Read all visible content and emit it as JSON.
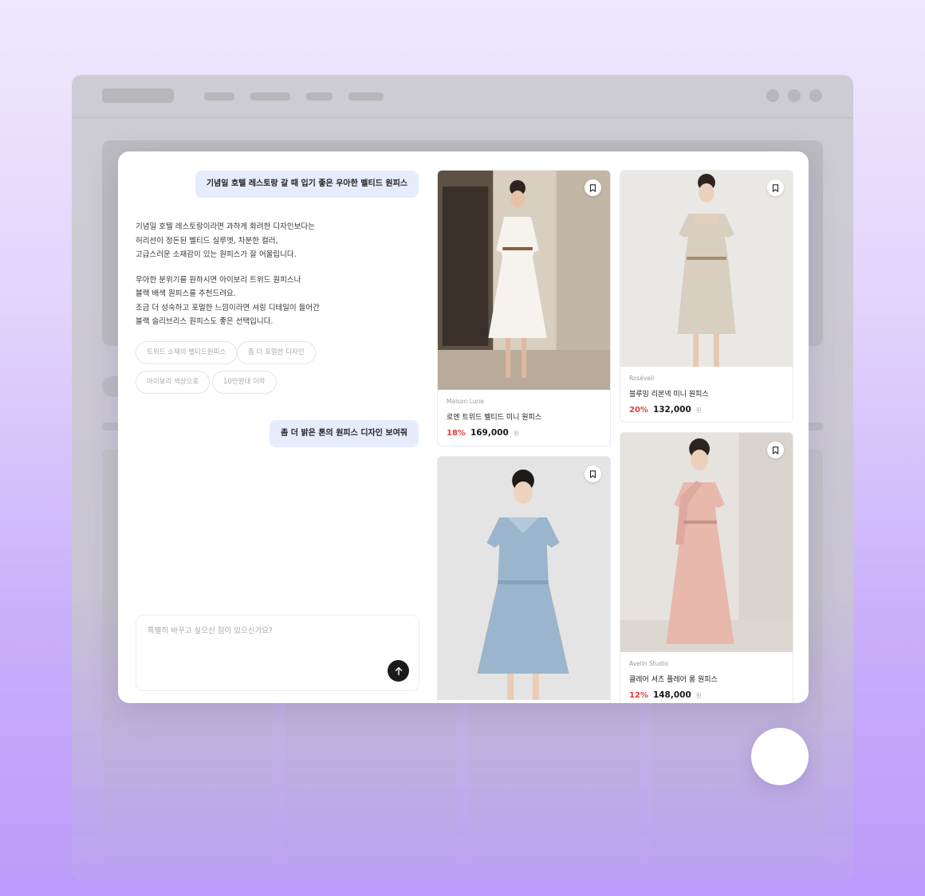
{
  "chat": {
    "messages": [
      {
        "role": "user",
        "text": "기념일 호텔 레스토랑 갈 때 입기 좋은 우아한 벨티드 원피스"
      },
      {
        "role": "assistant",
        "paragraphs": [
          [
            "기념일 호텔 레스토랑이라면 과하게 화려한 디자인보다는",
            "허리선이 정돈된 벨티드 실루엣, 차분한 컬러,",
            "고급스러운 소재감이 있는 원피스가 잘 어울립니다."
          ],
          [
            "우아한 분위기를 원하시면 아이보리 트위드 원피스나",
            "블랙 배색 원피스를 추천드려요.",
            "조금 더 성숙하고 포멀한 느낌이라면 셔링 디테일이 들어간",
            "블랙 슬리브리스 원피스도 좋은 선택입니다."
          ]
        ]
      },
      {
        "role": "user",
        "text": "좀 더 밝은 톤의 원피스 디자인 보여줘"
      }
    ],
    "suggestions": [
      "트위드 소재의 벨티드원피스",
      "좀 더 포멀한 디자인",
      "아이보리 색상으로",
      "10만원대 이하"
    ],
    "input": {
      "value": "",
      "placeholder": "특별히 바꾸고 싶으신 점이 있으신가요?"
    }
  },
  "products": [
    {
      "brand": "Maison Lune",
      "name": "로엔 트위드 벨티드 미니 원피스",
      "discount": "18%",
      "price": "169,000",
      "currency": "원",
      "color": "white"
    },
    {
      "brand": "Roséveil",
      "name": "블루밍 리본넥 미니 원피스",
      "discount": "20%",
      "price": "132,000",
      "currency": "원",
      "color": "ivory"
    },
    {
      "brand": "",
      "name": "",
      "discount": "",
      "price": "",
      "currency": "",
      "color": "denim-blue"
    },
    {
      "brand": "Avelin Studio",
      "name": "클레어 셔츠 플레어 롱 원피스",
      "discount": "12%",
      "price": "148,000",
      "currency": "원",
      "color": "blush-pink"
    }
  ],
  "colors": {
    "accent_red": "#e53b3b",
    "user_bubble": "#e5ecfc",
    "send_button": "#1b1b1f"
  }
}
